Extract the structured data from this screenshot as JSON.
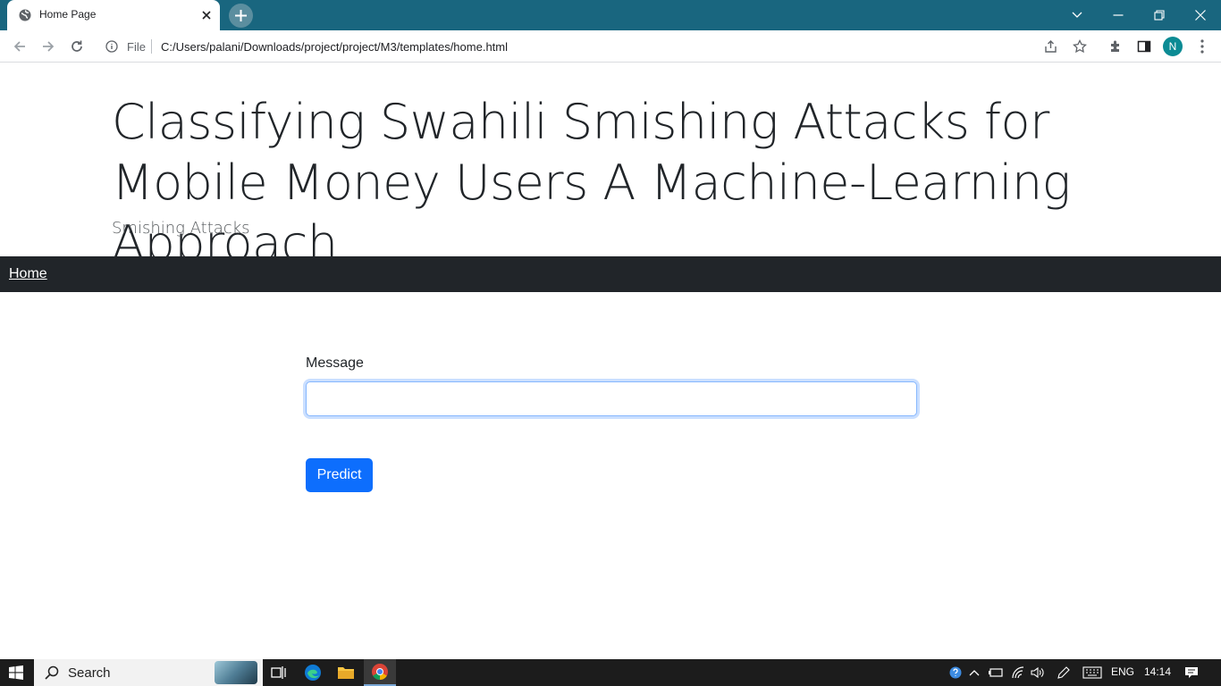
{
  "browser": {
    "tab_title": "Home Page",
    "scheme_label": "File",
    "url": "C:/Users/palani/Downloads/project/project/M3/templates/home.html",
    "profile_initial": "N"
  },
  "page": {
    "title": "Classifying Swahili Smishing Attacks for Mobile Money Users A Machine-Learning Approach",
    "subtitle": "Smishing Attacks",
    "nav_home": "Home",
    "message_label": "Message",
    "message_value": "",
    "predict_label": "Predict"
  },
  "taskbar": {
    "search_placeholder": "Search",
    "language": "ENG",
    "time": "14:14"
  },
  "colors": {
    "titlebar": "#19667f",
    "navbar": "#212529",
    "primary": "#0d6efd"
  },
  "icons": [
    "globe-icon",
    "close-icon",
    "plus-icon",
    "chevron-down-icon",
    "minimize-icon",
    "restore-icon",
    "back-icon",
    "forward-icon",
    "reload-icon",
    "info-icon",
    "share-icon",
    "star-icon",
    "extensions-icon",
    "sidepanel-icon",
    "kebab-icon",
    "windows-icon",
    "search-icon",
    "taskview-icon",
    "edge-icon",
    "folder-icon",
    "chrome-icon",
    "help-icon",
    "caret-up-icon",
    "battery-icon",
    "wifi-icon",
    "volume-icon",
    "pen-icon",
    "keyboard-icon",
    "notification-icon"
  ]
}
